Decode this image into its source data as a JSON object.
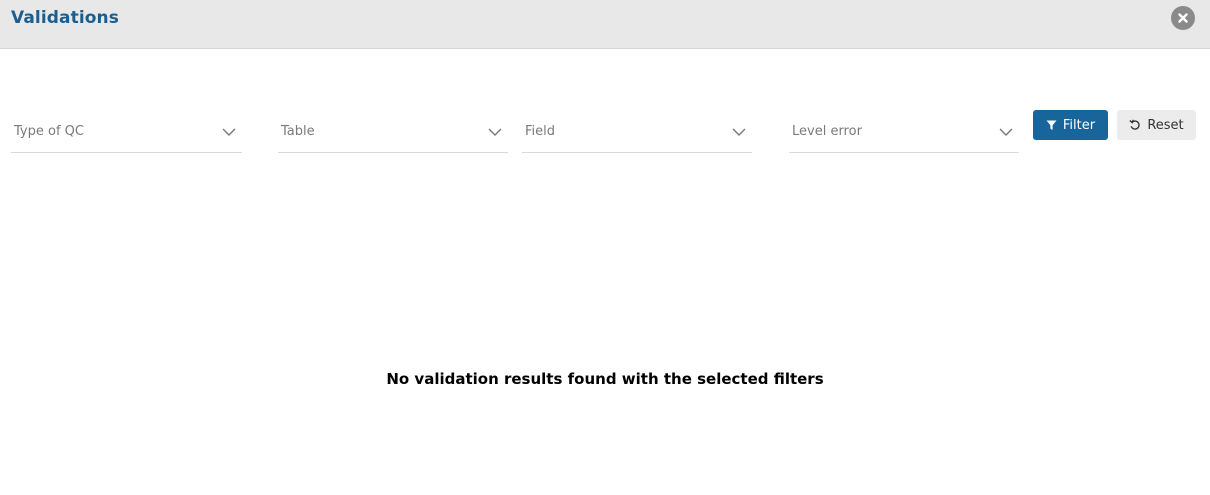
{
  "header": {
    "title": "Validations",
    "close_icon": "close-circle-icon"
  },
  "filters": {
    "type_of_qc": {
      "placeholder": "Type of QC"
    },
    "table": {
      "placeholder": "Table"
    },
    "field": {
      "placeholder": "Field"
    },
    "level_error": {
      "placeholder": "Level error"
    }
  },
  "actions": {
    "filter_label": "Filter",
    "filter_icon": "funnel-icon",
    "reset_label": "Reset",
    "reset_icon": "undo-icon"
  },
  "results": {
    "empty_message": "No validation results found with the selected filters"
  },
  "colors": {
    "title": "#1a5f8f",
    "primary_button": "#17659b",
    "header_bg": "#e8e8e8"
  }
}
